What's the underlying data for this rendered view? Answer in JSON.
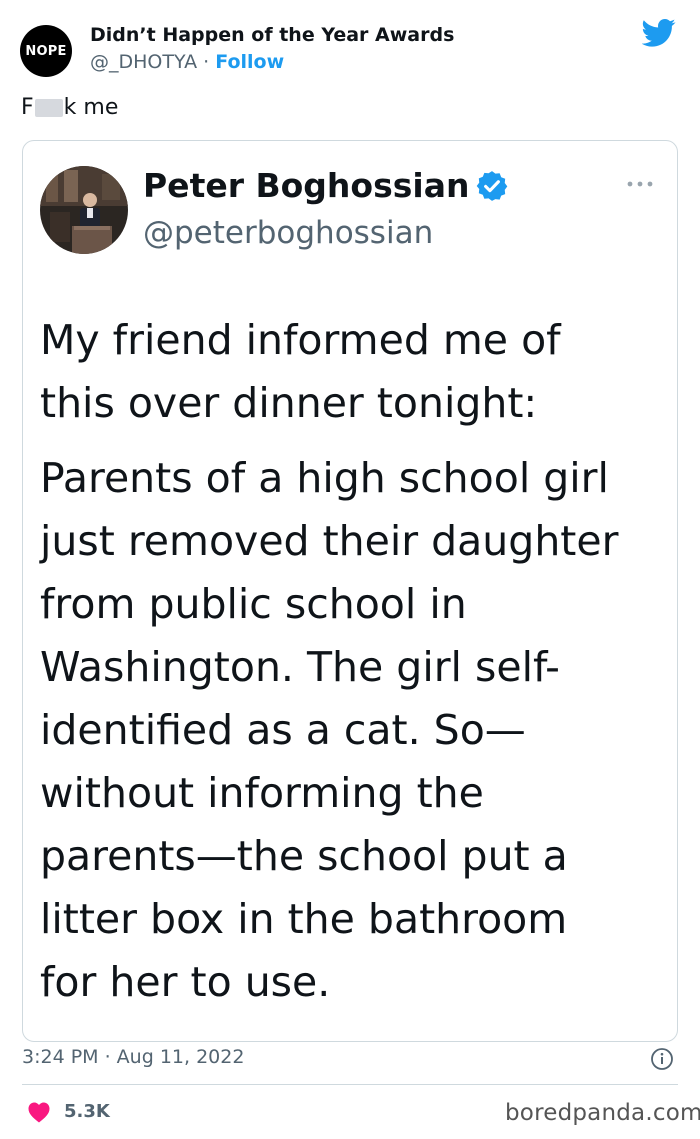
{
  "tweet": {
    "author_avatar_text": "NOPE",
    "author_name": "Didn’t Happen of the Year Awards",
    "author_handle": "@_DHOTYA",
    "separator": " · ",
    "follow_label": "Follow",
    "text_before_censor": "F",
    "text_after_censor": "k me",
    "timestamp": "3:24 PM · Aug 11, 2022",
    "like_count": "5.3K",
    "brand_color": "#1d9bf0"
  },
  "quoted_tweet": {
    "name": "Peter Boghossian",
    "handle": "@peterboghossian",
    "paragraph_1": "My friend informed me of\nthis over dinner tonight:",
    "paragraph_2": "Parents of a high school girl\njust removed their daughter\nfrom public school in\nWashington. The girl self-\nidentified as a cat. So—\nwithout informing the\nparents—the school put a\nlitter box in the bathroom\nfor her to use."
  },
  "watermark": "boredpanda.com",
  "icons": [
    "twitter-bird-icon",
    "verified-badge-icon",
    "more-options-icon",
    "info-icon",
    "heart-icon"
  ]
}
